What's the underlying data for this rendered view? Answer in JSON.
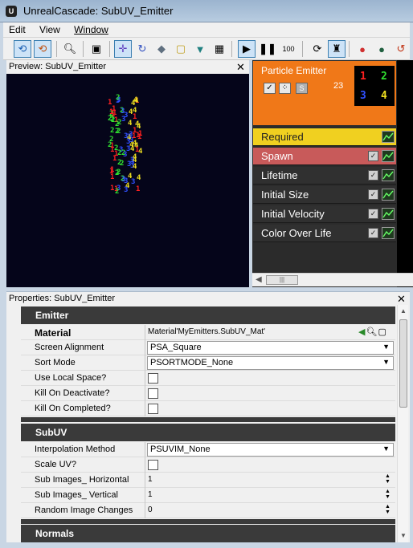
{
  "window": {
    "title": "UnrealCascade: SubUV_Emitter"
  },
  "menu": [
    {
      "label": "Edit"
    },
    {
      "label": "View"
    },
    {
      "label": "Window"
    }
  ],
  "toolbar": {
    "icons": [
      "restart-sim-icon",
      "restart-level-icon",
      "find-in-browser-icon",
      "save-thumbnail-icon",
      "toggle-orbit-icon",
      "toggle-origin-axis-icon",
      "background-color-icon",
      "wireframe-sphere-icon",
      "bounds-icon",
      "post-process-icon",
      "grid-icon",
      "play-icon",
      "pause-icon",
      "speed-icon",
      "loop-icon",
      "realtime-icon",
      "lod-icon",
      "sphere-icon",
      "undo-icon"
    ],
    "speed_label": "100"
  },
  "preview": {
    "title": "Preview: SubUV_Emitter",
    "close": "✕"
  },
  "emitter": {
    "name": "Particle Emitter",
    "count": "23",
    "thumbnail_digits": [
      "1",
      "2",
      "3",
      "4"
    ],
    "thumbnail_colors": [
      "#ff2020",
      "#30e030",
      "#3050ff",
      "#f0e020"
    ]
  },
  "modules": [
    {
      "label": "Required"
    },
    {
      "label": "Spawn"
    },
    {
      "label": "Lifetime"
    },
    {
      "label": "Initial Size"
    },
    {
      "label": "Initial Velocity"
    },
    {
      "label": "Color Over Life"
    }
  ],
  "properties": {
    "title": "Properties: SubUV_Emitter",
    "close": "✕",
    "categories": {
      "emitter": "Emitter",
      "subuv": "SubUV",
      "normals": "Normals"
    },
    "rows": {
      "material": {
        "label": "Material",
        "value": "Material'MyEmitters.SubUV_Mat'"
      },
      "screen_alignment": {
        "label": "Screen Alignment",
        "value": "PSA_Square"
      },
      "sort_mode": {
        "label": "Sort Mode",
        "value": "PSORTMODE_None"
      },
      "use_local_space": {
        "label": "Use Local Space?"
      },
      "kill_on_deactivate": {
        "label": "Kill On Deactivate?"
      },
      "kill_on_completed": {
        "label": "Kill On Completed?"
      },
      "interpolation_method": {
        "label": "Interpolation Method",
        "value": "PSUVIM_None"
      },
      "scale_uv": {
        "label": "Scale UV?"
      },
      "sub_images_horizontal": {
        "label": "Sub Images_ Horizontal",
        "value": "1"
      },
      "sub_images_vertical": {
        "label": "Sub Images_ Vertical",
        "value": "1"
      },
      "random_image_changes": {
        "label": "Random Image Changes",
        "value": "0"
      }
    }
  },
  "colors": {
    "emitter_orange": "#f07818",
    "required_yellow": "#f0d020",
    "spawn_red": "#c85a5a",
    "module_dark": "#303030",
    "viewport_bg": "#05051a"
  }
}
